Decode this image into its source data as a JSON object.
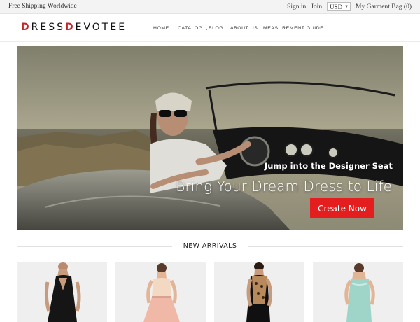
{
  "topbar": {
    "shipping": "Free Shipping Worldwide",
    "sign_in": "Sign in",
    "join": "Join",
    "currency": "USD",
    "bag": "My Garment Bag (0)"
  },
  "logo": {
    "part1": "RESS",
    "part2": "EVOTEE"
  },
  "nav": {
    "home": "HOME",
    "catalog": "CATALOG",
    "blog": "BLOG",
    "about": "ABOUT US",
    "measurement": "MEASUREMENT GUIDE"
  },
  "hero": {
    "subtitle": "Jump into the Designer  Seat",
    "title": "Bring Your Dream Dress to Life",
    "cta": "Create Now"
  },
  "section": {
    "new_arrivals": "NEW ARRIVALS"
  },
  "products": [
    {
      "name": "black-halter-dress",
      "color": "#151515"
    },
    {
      "name": "blush-pink-dress",
      "color": "#f0b8a6"
    },
    {
      "name": "leopard-black-dress",
      "color": "#b8895a"
    },
    {
      "name": "mint-strapless-dress",
      "color": "#9fd4c8"
    }
  ],
  "colors": {
    "accent": "#e41e1e",
    "logo_mark": "#c6252b"
  }
}
